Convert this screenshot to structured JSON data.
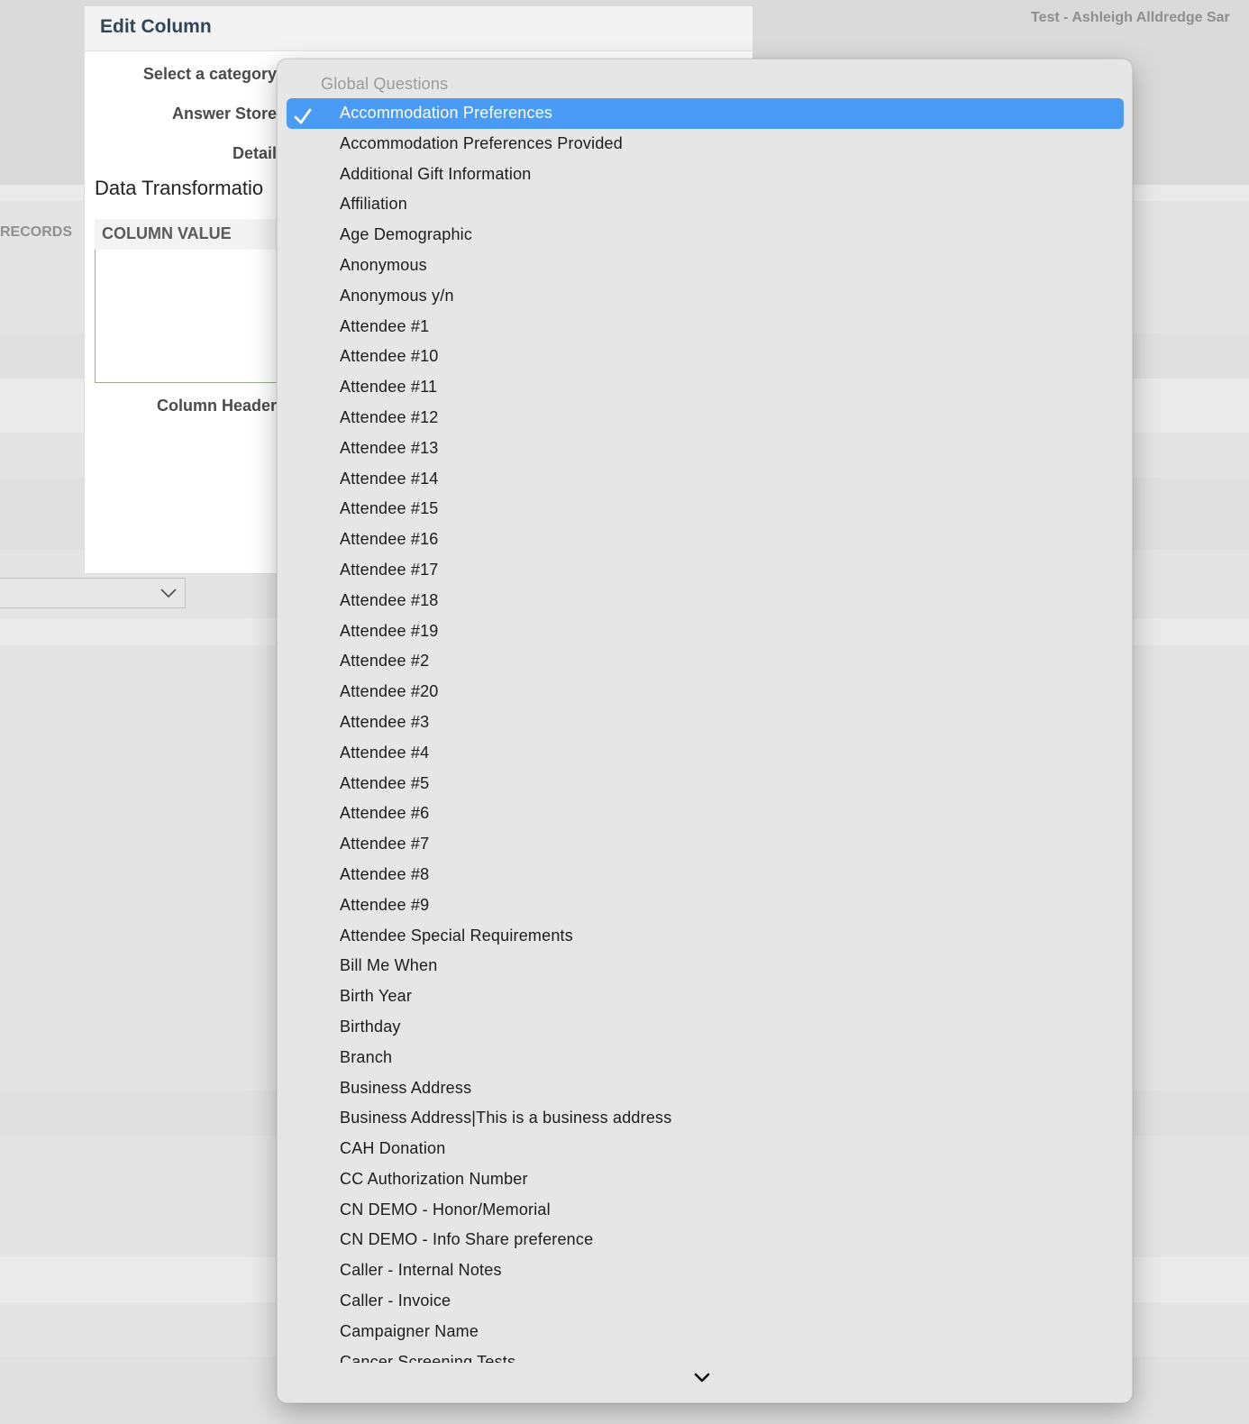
{
  "header": {
    "tenant": "Test - Ashleigh Alldredge Sar"
  },
  "background": {
    "records_label": "RECORDS"
  },
  "panel": {
    "title": "Edit Column",
    "labels": {
      "category": "Select a category",
      "answer_store": "Answer Store",
      "detail": "Detail",
      "column_header": "Column Header"
    },
    "data_transformation": "Data Transformatio",
    "column_value": "COLUMN VALUE"
  },
  "dropdown": {
    "group_label": "Global Questions",
    "selected_index": 0,
    "options": [
      "Accommodation Preferences",
      "Accommodation Preferences Provided",
      "Additional Gift Information",
      "Affiliation",
      "Age Demographic",
      "Anonymous",
      "Anonymous y/n",
      "Attendee #1",
      "Attendee #10",
      "Attendee #11",
      "Attendee #12",
      "Attendee #13",
      "Attendee #14",
      "Attendee #15",
      "Attendee #16",
      "Attendee #17",
      "Attendee #18",
      "Attendee #19",
      "Attendee #2",
      "Attendee #20",
      "Attendee #3",
      "Attendee #4",
      "Attendee #5",
      "Attendee #6",
      "Attendee #7",
      "Attendee #8",
      "Attendee #9",
      "Attendee Special Requirements",
      "Bill Me When",
      "Birth Year",
      "Birthday",
      "Branch",
      "Business Address",
      "Business Address|This is a business address",
      "CAH Donation",
      "CC Authorization Number",
      "CN DEMO - Honor/Memorial",
      "CN DEMO - Info Share preference",
      "Caller - Internal Notes",
      "Caller - Invoice",
      "Campaigner Name",
      "Cancer Screening Tests"
    ],
    "icons": {
      "check": "checkmark-icon",
      "scroll": "chevron-down-icon"
    }
  },
  "colors": {
    "selection": "#4a9bf5",
    "panel_title": "#2f4558"
  }
}
